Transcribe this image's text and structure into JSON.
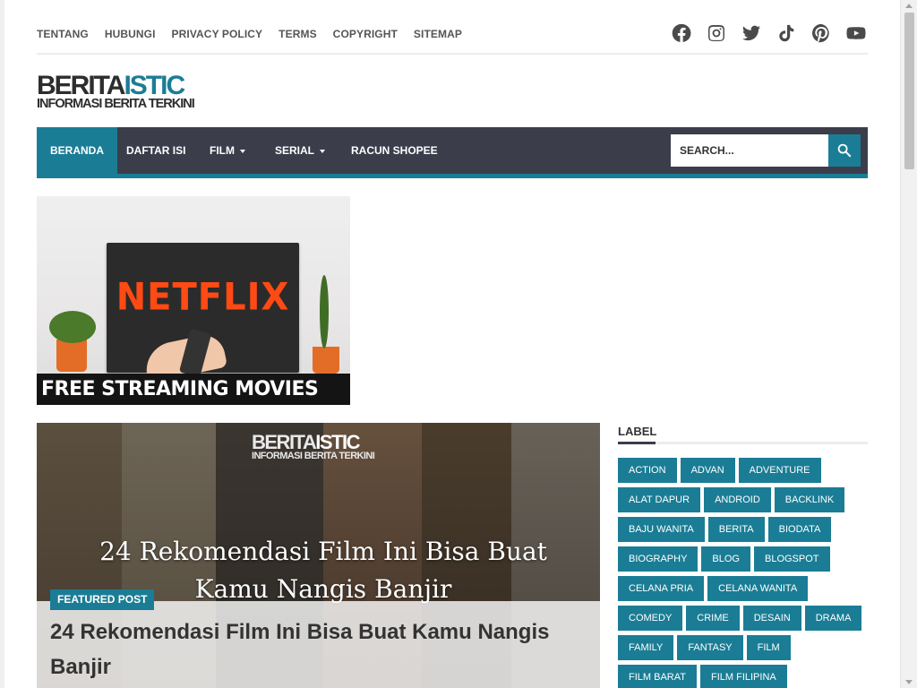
{
  "top_links": [
    "TENTANG",
    "HUBUNGI",
    "PRIVACY POLICY",
    "TERMS",
    "COPYRIGHT",
    "SITEMAP"
  ],
  "social_icons": [
    "facebook-icon",
    "instagram-icon",
    "twitter-icon",
    "tiktok-icon",
    "pinterest-icon",
    "youtube-icon"
  ],
  "logo": {
    "part1": "BERITA",
    "part2": "ISTIC",
    "tagline": "INFORMASI BERITA TERKINI"
  },
  "nav": {
    "items": [
      "BERANDA",
      "DAFTAR ISI",
      "FILM",
      "SERIAL",
      "RACUN SHOPEE"
    ],
    "search_placeholder": "SEARCH..."
  },
  "banner": {
    "brand": "NETFLIX",
    "caption": "FREE STREAMING MOVIES ONLINE >"
  },
  "featured": {
    "badge": "FEATURED POST",
    "overlay_title": "24 Rekomendasi Film Ini Bisa Buat Kamu Nangis Banjir",
    "title": "24 Rekomendasi Film Ini Bisa Buat Kamu Nangis Banjir"
  },
  "sidebar": {
    "heading": "LABEL",
    "labels": [
      "ACTION",
      "ADVAN",
      "ADVENTURE",
      "ALAT DAPUR",
      "ANDROID",
      "BACKLINK",
      "BAJU WANITA",
      "BERITA",
      "BIODATA",
      "BIOGRAPHY",
      "BLOG",
      "BLOGSPOT",
      "CELANA PRIA",
      "CELANA WANITA",
      "COMEDY",
      "CRIME",
      "DESAIN",
      "DRAMA",
      "FAMILY",
      "FANTASY",
      "FILM",
      "FILM BARAT",
      "FILM FILIPINA"
    ]
  },
  "colors": {
    "accent": "#1a7d95",
    "nav_bg": "#3b3d4b"
  }
}
